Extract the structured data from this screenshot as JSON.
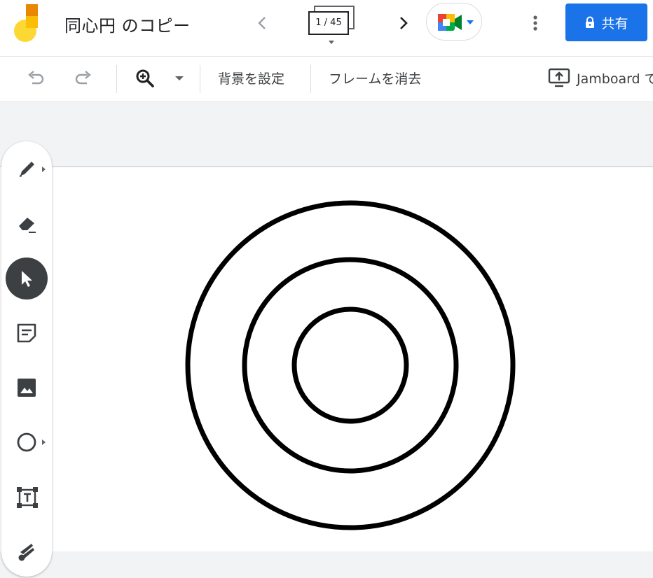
{
  "header": {
    "title": "同心円 のコピー",
    "frame_counter": "1 / 45",
    "share_label": "共有"
  },
  "toolbar": {
    "set_background": "背景を設定",
    "clear_frame": "フレームを消去",
    "cast_label": "Jamboard で"
  },
  "icons": {
    "logo": "jamboard-logo",
    "prev": "chevron-left-icon",
    "next": "chevron-right-icon",
    "meet": "google-meet-icon",
    "more": "more-vert-icon",
    "lock": "lock-icon",
    "undo": "undo-icon",
    "redo": "redo-icon",
    "zoom": "zoom-in-icon",
    "cast": "present-to-jamboard-icon"
  },
  "colors": {
    "accent": "#1a73e8",
    "toolbar_bg": "#ffffff",
    "page_bg": "#f1f3f4",
    "active_tool": "#3c4043"
  },
  "tools": [
    {
      "name": "pen-tool",
      "icon": "pen-icon",
      "has_menu": true
    },
    {
      "name": "eraser-tool",
      "icon": "eraser-icon",
      "has_menu": false
    },
    {
      "name": "select-tool",
      "icon": "cursor-icon",
      "has_menu": false,
      "active": true
    },
    {
      "name": "sticky-note-tool",
      "icon": "sticky-note-icon",
      "has_menu": false
    },
    {
      "name": "image-tool",
      "icon": "image-icon",
      "has_menu": false
    },
    {
      "name": "shape-tool",
      "icon": "circle-icon",
      "has_menu": true
    },
    {
      "name": "text-box-tool",
      "icon": "text-box-icon",
      "has_menu": false
    },
    {
      "name": "laser-tool",
      "icon": "laser-icon",
      "has_menu": false
    }
  ]
}
